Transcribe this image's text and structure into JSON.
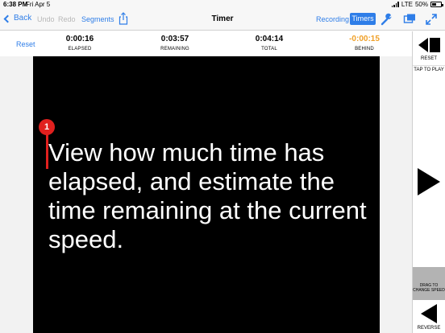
{
  "status_bar": {
    "time": "6:38 PM",
    "date": "Fri Apr 5",
    "network": "LTE",
    "battery": "50%"
  },
  "nav": {
    "back_label": "Back",
    "undo_label": "Undo",
    "redo_label": "Redo",
    "segments_label": "Segments",
    "title": "Timer",
    "recording_label": "Recording",
    "timers_label": "Timers"
  },
  "stats": {
    "reset_label": "Reset",
    "elapsed": {
      "value": "0:00:16",
      "label": "ELAPSED"
    },
    "remaining": {
      "value": "0:03:57",
      "label": "REMAINING"
    },
    "total": {
      "value": "0:04:14",
      "label": "TOTAL"
    },
    "behind": {
      "value": "-0:00:15",
      "label": "BEHIND"
    }
  },
  "prompter": {
    "marker_number": "1",
    "text": "View how much time has elapsed, and estimate the time remaining at the current speed."
  },
  "controls": {
    "reset_label": "RESET",
    "tap_to_play_label": "TAP TO PLAY",
    "speed_label": "DRAG TO CHANGE SPEED",
    "reverse_label": "REVERSE"
  },
  "colors": {
    "accent": "#2f7ee8",
    "behind": "#f0a028",
    "marker": "#e0201e",
    "prompter_bg": "#000000"
  }
}
